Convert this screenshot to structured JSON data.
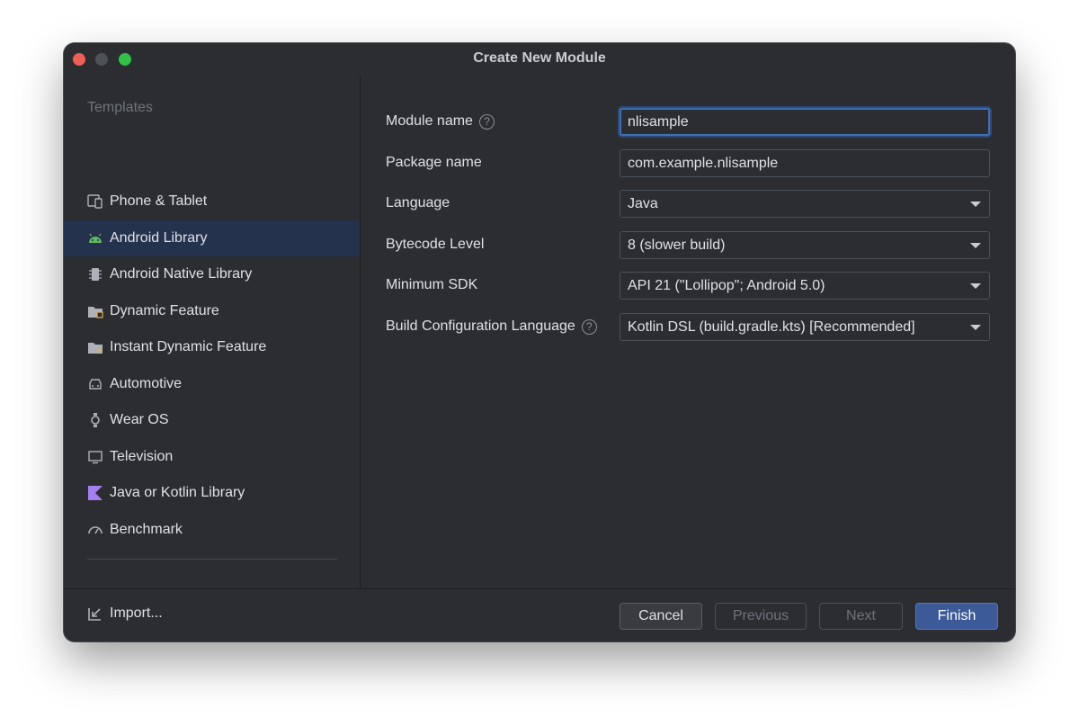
{
  "window": {
    "title": "Create New Module"
  },
  "sidebar": {
    "heading": "Templates",
    "items": [
      {
        "label": "Phone & Tablet",
        "icon": "phone-tablet-icon"
      },
      {
        "label": "Android Library",
        "icon": "android-icon",
        "selected": true
      },
      {
        "label": "Android Native Library",
        "icon": "chip-icon"
      },
      {
        "label": "Dynamic Feature",
        "icon": "folder-dynamic-icon"
      },
      {
        "label": "Instant Dynamic Feature",
        "icon": "folder-instant-icon"
      },
      {
        "label": "Automotive",
        "icon": "car-icon"
      },
      {
        "label": "Wear OS",
        "icon": "watch-icon"
      },
      {
        "label": "Television",
        "icon": "tv-icon"
      },
      {
        "label": "Java or Kotlin Library",
        "icon": "kotlin-icon"
      },
      {
        "label": "Benchmark",
        "icon": "gauge-icon"
      }
    ],
    "import_label": "Import..."
  },
  "form": {
    "module_name": {
      "label": "Module name",
      "value": "nlisample"
    },
    "package_name": {
      "label": "Package name",
      "value": "com.example.nlisample"
    },
    "language": {
      "label": "Language",
      "value": "Java"
    },
    "bytecode_level": {
      "label": "Bytecode Level",
      "value": "8 (slower build)"
    },
    "minimum_sdk": {
      "label": "Minimum SDK",
      "value": "API 21 (\"Lollipop\"; Android 5.0)"
    },
    "build_config_language": {
      "label": "Build Configuration Language",
      "value": "Kotlin DSL (build.gradle.kts) [Recommended]"
    }
  },
  "footer": {
    "cancel": "Cancel",
    "previous": "Previous",
    "next": "Next",
    "finish": "Finish"
  },
  "colors": {
    "window_bg": "#2b2d30",
    "selected_bg": "#25324d",
    "accent": "#3b5a97",
    "close": "#ee5f57",
    "maximize": "#2fc244"
  }
}
